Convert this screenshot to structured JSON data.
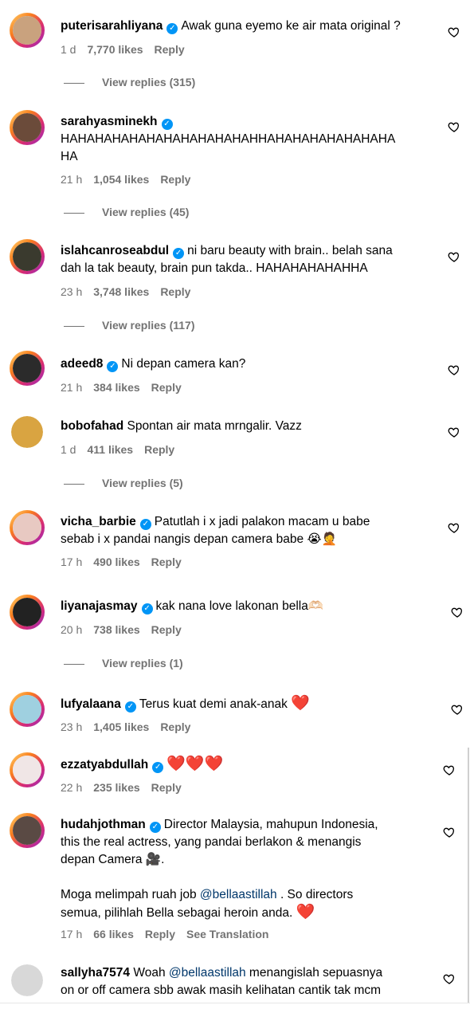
{
  "comments": [
    {
      "user": "puterisarahliyana",
      "verified": true,
      "text": "Awak guna eyemo ke air mata original ?",
      "time": "1 d",
      "likes": "7,770 likes",
      "reply": "Reply",
      "view_replies": "View replies (315)",
      "avatar_color": "#c9a27e"
    },
    {
      "user": "sarahyasminekh",
      "verified": true,
      "text": "HAHAHAHAHAHAHAHAHAHAHAHHAHAHAHAHAHAHAHA\nHA",
      "time": "21 h",
      "likes": "1,054 likes",
      "reply": "Reply",
      "view_replies": "View replies (45)",
      "avatar_color": "#6b4b3a"
    },
    {
      "user": "islahcanroseabdul",
      "verified": true,
      "text": "ni baru beauty with brain.. belah sana\ndah la tak beauty, brain pun takda.. HAHAHAHAHAHHA",
      "time": "23 h",
      "likes": "3,748 likes",
      "reply": "Reply",
      "view_replies": "View replies (117)",
      "avatar_color": "#3a3a2e"
    },
    {
      "user": "adeed8",
      "verified": true,
      "text": "Ni depan camera kan?",
      "time": "21 h",
      "likes": "384 likes",
      "reply": "Reply",
      "avatar_color": "#2b2b2b"
    },
    {
      "user": "bobofahad",
      "verified": false,
      "text": "Spontan air mata mrngalir. Vazz",
      "time": "1 d",
      "likes": "411 likes",
      "reply": "Reply",
      "view_replies": "View replies (5)",
      "avatar_color": "#d9a441"
    },
    {
      "user": "vicha_barbie",
      "verified": true,
      "text": "Patutlah i x jadi palakon macam u babe\nsebab i x pandai nangis depan camera babe 😭🤦",
      "time": "17 h",
      "likes": "490 likes",
      "reply": "Reply",
      "avatar_color": "#e8c9c2"
    },
    {
      "user": "liyanajasmay",
      "verified": true,
      "text": "kak nana love lakonan bella🫶🏻",
      "time": "20 h",
      "likes": "738 likes",
      "reply": "Reply",
      "view_replies": "View replies (1)",
      "avatar_color": "#222222"
    },
    {
      "user": "lufyalaana",
      "verified": true,
      "text": "Terus kuat demi anak-anak",
      "time": "23 h",
      "likes": "1,405 likes",
      "reply": "Reply",
      "avatar_color": "#9fd0e0"
    },
    {
      "user": "ezzatyabdullah",
      "verified": true,
      "text": "",
      "time": "22 h",
      "likes": "235 likes",
      "reply": "Reply",
      "avatar_color": "#f0e6e6"
    },
    {
      "user": "hudahjothman",
      "verified": true,
      "text": "Director Malaysia, mahupun Indonesia,\nthis the real actress, yang pandai berlakon & menangis\ndepan Camera 🎥.",
      "text2a": "Moga melimpah ruah job ",
      "mention": "@bellaastillah",
      "text2b": " . So directors\nsemua, pilihlah Bella sebagai heroin anda. ",
      "time": "17 h",
      "likes": "66 likes",
      "reply": "Reply",
      "translate": "See Translation",
      "avatar_color": "#5a4a44"
    },
    {
      "user": "sallyha7574",
      "verified": false,
      "text_a": "Woah ",
      "mention": "@bellaastillah",
      "text_b": " menangislah sepuasnya\non or off camera sbb awak masih kelihatan cantik tak mcm",
      "avatar_color": "#d8d8d8"
    }
  ],
  "icons": {
    "like": "heart-outline-icon",
    "verified": "verified-badge-icon",
    "red_heart": "red-heart-emoji"
  },
  "colors": {
    "verified": "#0095f6",
    "muted": "#737373",
    "mention": "#00376b",
    "red_heart": "#e0143c"
  },
  "red_heart_glyph": "❤️",
  "camera_glyph": "🎥"
}
